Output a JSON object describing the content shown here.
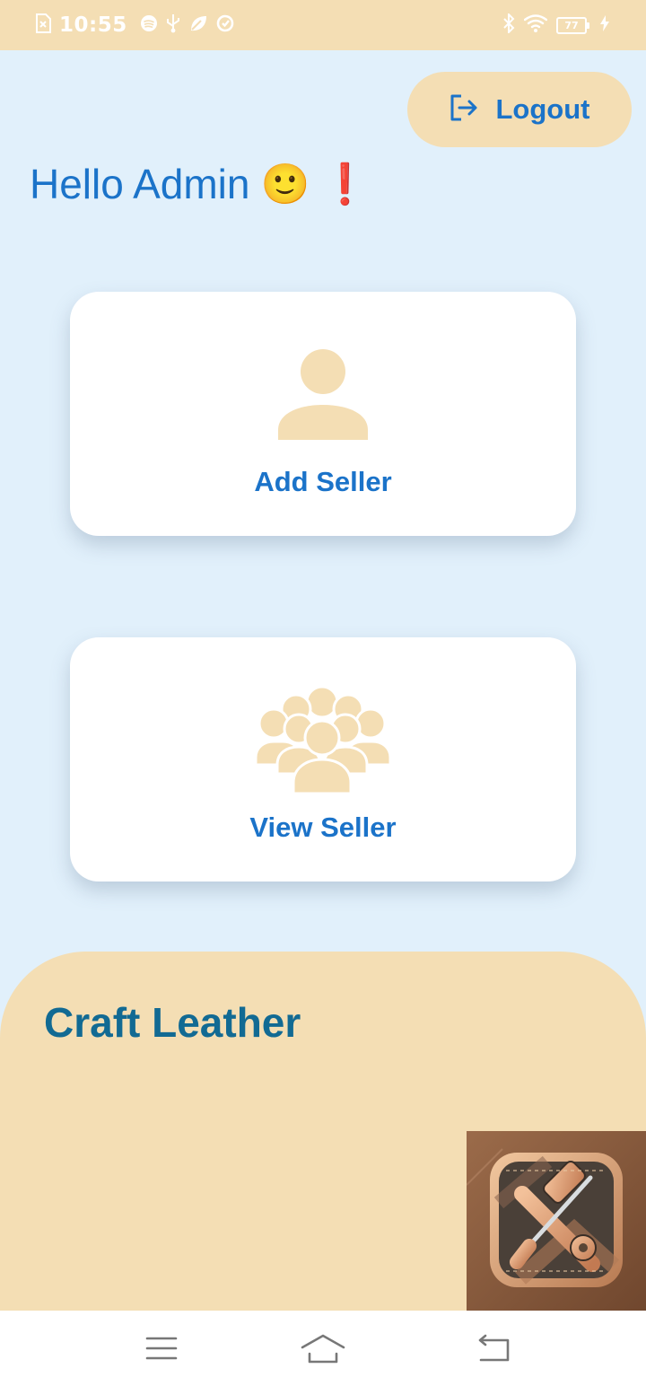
{
  "status_bar": {
    "time": "10:55",
    "battery_level": "77",
    "icons": [
      "sim-error-icon",
      "spotify-icon",
      "usb-icon",
      "leaf-icon",
      "sync-icon",
      "bluetooth-icon",
      "wifi-icon",
      "battery-icon",
      "charging-icon"
    ]
  },
  "header": {
    "logout_label": "Logout",
    "logout_icon": "logout-icon"
  },
  "greeting": {
    "text": "Hello Admin",
    "emoji_smile": "🙂",
    "emoji_exclaim": "❗"
  },
  "cards": [
    {
      "label": "Add Seller",
      "icon": "person-icon"
    },
    {
      "label": "View Seller",
      "icon": "group-icon"
    }
  ],
  "footer": {
    "brand": "Craft Leather",
    "logo_icon": "leather-tools-logo"
  },
  "nav_bar": {
    "icons": [
      "menu-icon",
      "home-icon",
      "back-icon"
    ]
  },
  "colors": {
    "accent_text": "#1b73c9",
    "beige": "#f4deb4",
    "background": "#e1f0fb",
    "brand_title": "#126a93"
  }
}
